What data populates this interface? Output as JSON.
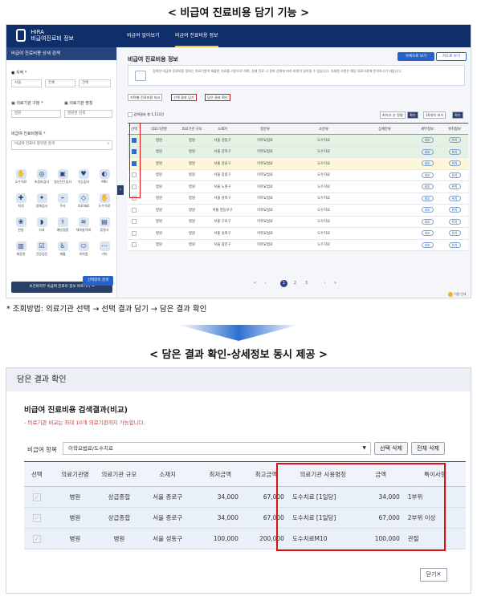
{
  "section1_title": "< 비급여 진료비용 담기 기능 >",
  "section2_title": "< 담은 결과 확인-상세정보 동시 제공 >",
  "method_text": "* 조회방법: 의료기관 선택 → 선택 결과 담기 → 담은 결과 확인",
  "app": {
    "logo_line1": "HIRA",
    "logo_line2": "비급여진료비 정보",
    "nav": [
      "비급여 알아보기",
      "비급여 진료비용 정보"
    ],
    "sidebar_title": "비급여 진료비용 상세 검색",
    "region_label": "● 지역 *",
    "region_selects": [
      "서울",
      "전체",
      "전체"
    ],
    "type_label": "▣ 의료기관 구분 *",
    "name_label": "▣ 의료기관 명칭",
    "type_value": "병원",
    "name_placeholder": "병원명 검색",
    "item_label": "비급여 진료비항목 *",
    "item_placeholder": "비급여 진료비 항목명 검색",
    "icons": [
      "도수치료",
      "초음파검사",
      "영상진단검사",
      "기능검사",
      "MRI",
      "처치",
      "생체검사",
      "주사",
      "치료재료",
      "도수치료",
      "한방",
      "치과",
      "예방접종",
      "체외충격파",
      "증명서",
      "제증명",
      "건강검진",
      "재활",
      "의약품",
      "기타"
    ],
    "side_banner": "보건복지부 비급여 진료비 정보 바로가기 →",
    "search_button": "선택항목 검색",
    "main_title": "비급여 진료비용 정보",
    "tab_buttons": [
      "목록으로 보기",
      "지도로 보기"
    ],
    "notice": "검색한 비급여 진료비용 정보는 의료기관이 제출한 자료를 기준으로 하며, 실제 진료 시 환자 상태에 따라 비용이 달라질 수 있습니다. 자세한 사항은 해당 의료기관에 문의하시기 바랍니다.",
    "tool_buttons": [
      "지역별 진료비용 비교",
      "선택 결과 담기",
      "담은 결과 확인"
    ],
    "result_count": "검색결과 총 1,112건",
    "right_tools": [
      "최저가 순 정렬",
      "확인",
      "10개씩 보기",
      "확인"
    ],
    "table_headers": [
      "선택",
      "의료기관명",
      "의료기관 규모",
      "소재지",
      "중분류",
      "소분류",
      "상세분류",
      "세부정보",
      "위치정보"
    ],
    "rows": [
      {
        "name": "병원",
        "size": "병원",
        "addr": "서울 성동구",
        "mid": "이학요법료",
        "small": "도수치료",
        "detail": "",
        "info": "세부",
        "map": "위치",
        "checked": true,
        "hl": "sel"
      },
      {
        "name": "병원",
        "size": "병원",
        "addr": "서울 관악구",
        "mid": "이학요법료",
        "small": "도수치료",
        "detail": "",
        "info": "세부",
        "map": "위치",
        "checked": true,
        "hl": "sel"
      },
      {
        "name": "병원",
        "size": "병원",
        "addr": "서울 강남구",
        "mid": "이학요법료",
        "small": "도수치료",
        "detail": "",
        "info": "세부",
        "map": "위치",
        "checked": true,
        "hl": "sel2"
      },
      {
        "name": "병원",
        "size": "병원",
        "addr": "서울 중랑구",
        "mid": "이학요법료",
        "small": "도수치료",
        "detail": "",
        "info": "세부",
        "map": "위치",
        "checked": false,
        "hl": ""
      },
      {
        "name": "병원",
        "size": "병원",
        "addr": "서울 노원구",
        "mid": "이학요법료",
        "small": "도수치료",
        "detail": "",
        "info": "세부",
        "map": "위치",
        "checked": false,
        "hl": ""
      },
      {
        "name": "병원",
        "size": "병원",
        "addr": "서울 강북구",
        "mid": "이학요법료",
        "small": "도수치료",
        "detail": "",
        "info": "세부",
        "map": "위치",
        "checked": false,
        "hl": ""
      },
      {
        "name": "병원",
        "size": "병원",
        "addr": "서울 영등포구",
        "mid": "이학요법료",
        "small": "도수치료",
        "detail": "",
        "info": "세부",
        "map": "위치",
        "checked": false,
        "hl": ""
      },
      {
        "name": "병원",
        "size": "병원",
        "addr": "서울 구로구",
        "mid": "이학요법료",
        "small": "도수치료",
        "detail": "",
        "info": "세부",
        "map": "위치",
        "checked": false,
        "hl": ""
      },
      {
        "name": "병원",
        "size": "병원",
        "addr": "서울 송파구",
        "mid": "이학요법료",
        "small": "도수치료",
        "detail": "",
        "info": "세부",
        "map": "위치",
        "checked": false,
        "hl": ""
      },
      {
        "name": "병원",
        "size": "병원",
        "addr": "서울 광진구",
        "mid": "이학요법료",
        "small": "도수치료",
        "detail": "",
        "info": "세부",
        "map": "위치",
        "checked": false,
        "hl": ""
      }
    ],
    "pages": [
      "«",
      "‹",
      "1",
      "2",
      "3",
      "›",
      "»"
    ],
    "help_badge": "이용 안내"
  },
  "modal": {
    "header": "담은 결과 확인",
    "title": "비급여 진료비용 검색결과(비교)",
    "note": "- 의료기관 비교는 최대 10개 의료기관까지 가능합니다.",
    "item_label": "비급여 항목",
    "item_value": "이학요법료/도수치료",
    "btn_delete_selected": "선택 삭제",
    "btn_delete_all": "전체 삭제",
    "headers": [
      "선택",
      "의료기관명",
      "의료기관 규모",
      "소재지",
      "최저금액",
      "최고금액",
      "의료기관 사용명칭",
      "금액",
      "특이사항"
    ],
    "rows": [
      {
        "name": "병원",
        "size": "상급종합",
        "addr": "서울 종로구",
        "min": "34,000",
        "max": "67,000",
        "used": "도수치료 [1일당]",
        "amt": "34,000",
        "note": "1부위"
      },
      {
        "name": "병원",
        "size": "상급종합",
        "addr": "서울 종로구",
        "min": "34,000",
        "max": "67,000",
        "used": "도수치료 [1일당]",
        "amt": "67,000",
        "note": "2부위 이상"
      },
      {
        "name": "병원",
        "size": "병원",
        "addr": "서울 성동구",
        "min": "100,000",
        "max": "200,000",
        "used": "도수치료M10",
        "amt": "100,000",
        "note": "관절"
      }
    ],
    "close_label": "닫기✕"
  }
}
